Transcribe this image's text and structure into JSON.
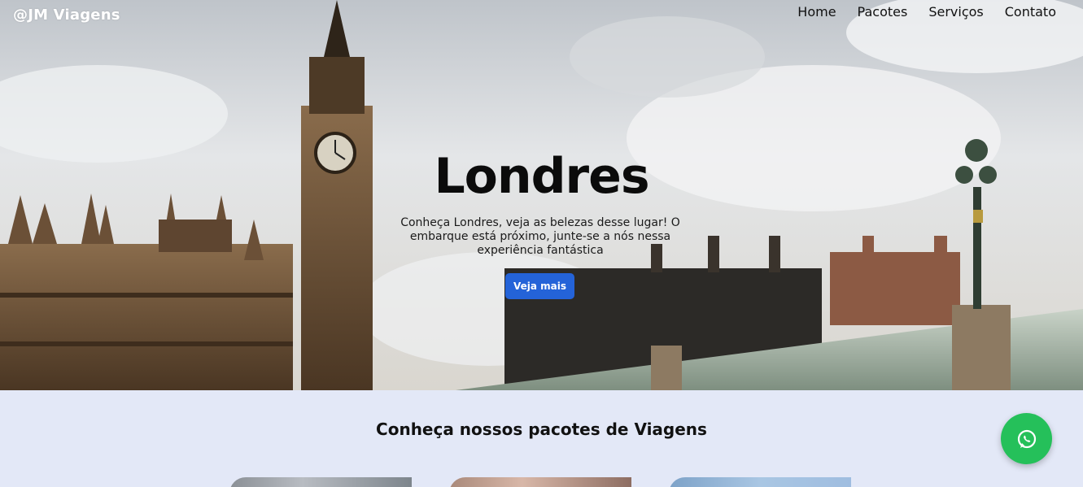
{
  "header": {
    "brand": "@JM Viagens",
    "nav": [
      "Home",
      "Pacotes",
      "Serviços",
      "Contato"
    ]
  },
  "hero": {
    "title": "Londres",
    "text": "Conheça Londres, veja as belezas desse lugar! O embarque está próximo, junte-se a nós nessa experiência fantástica",
    "button": "Veja mais"
  },
  "packages": {
    "title": "Conheça nossos pacotes de Viagens"
  },
  "colors": {
    "accent": "#2463d8",
    "whatsapp": "#25c05a",
    "section_bg": "#e3e8f7"
  },
  "icons": {
    "floating_button": "whatsapp-icon"
  }
}
